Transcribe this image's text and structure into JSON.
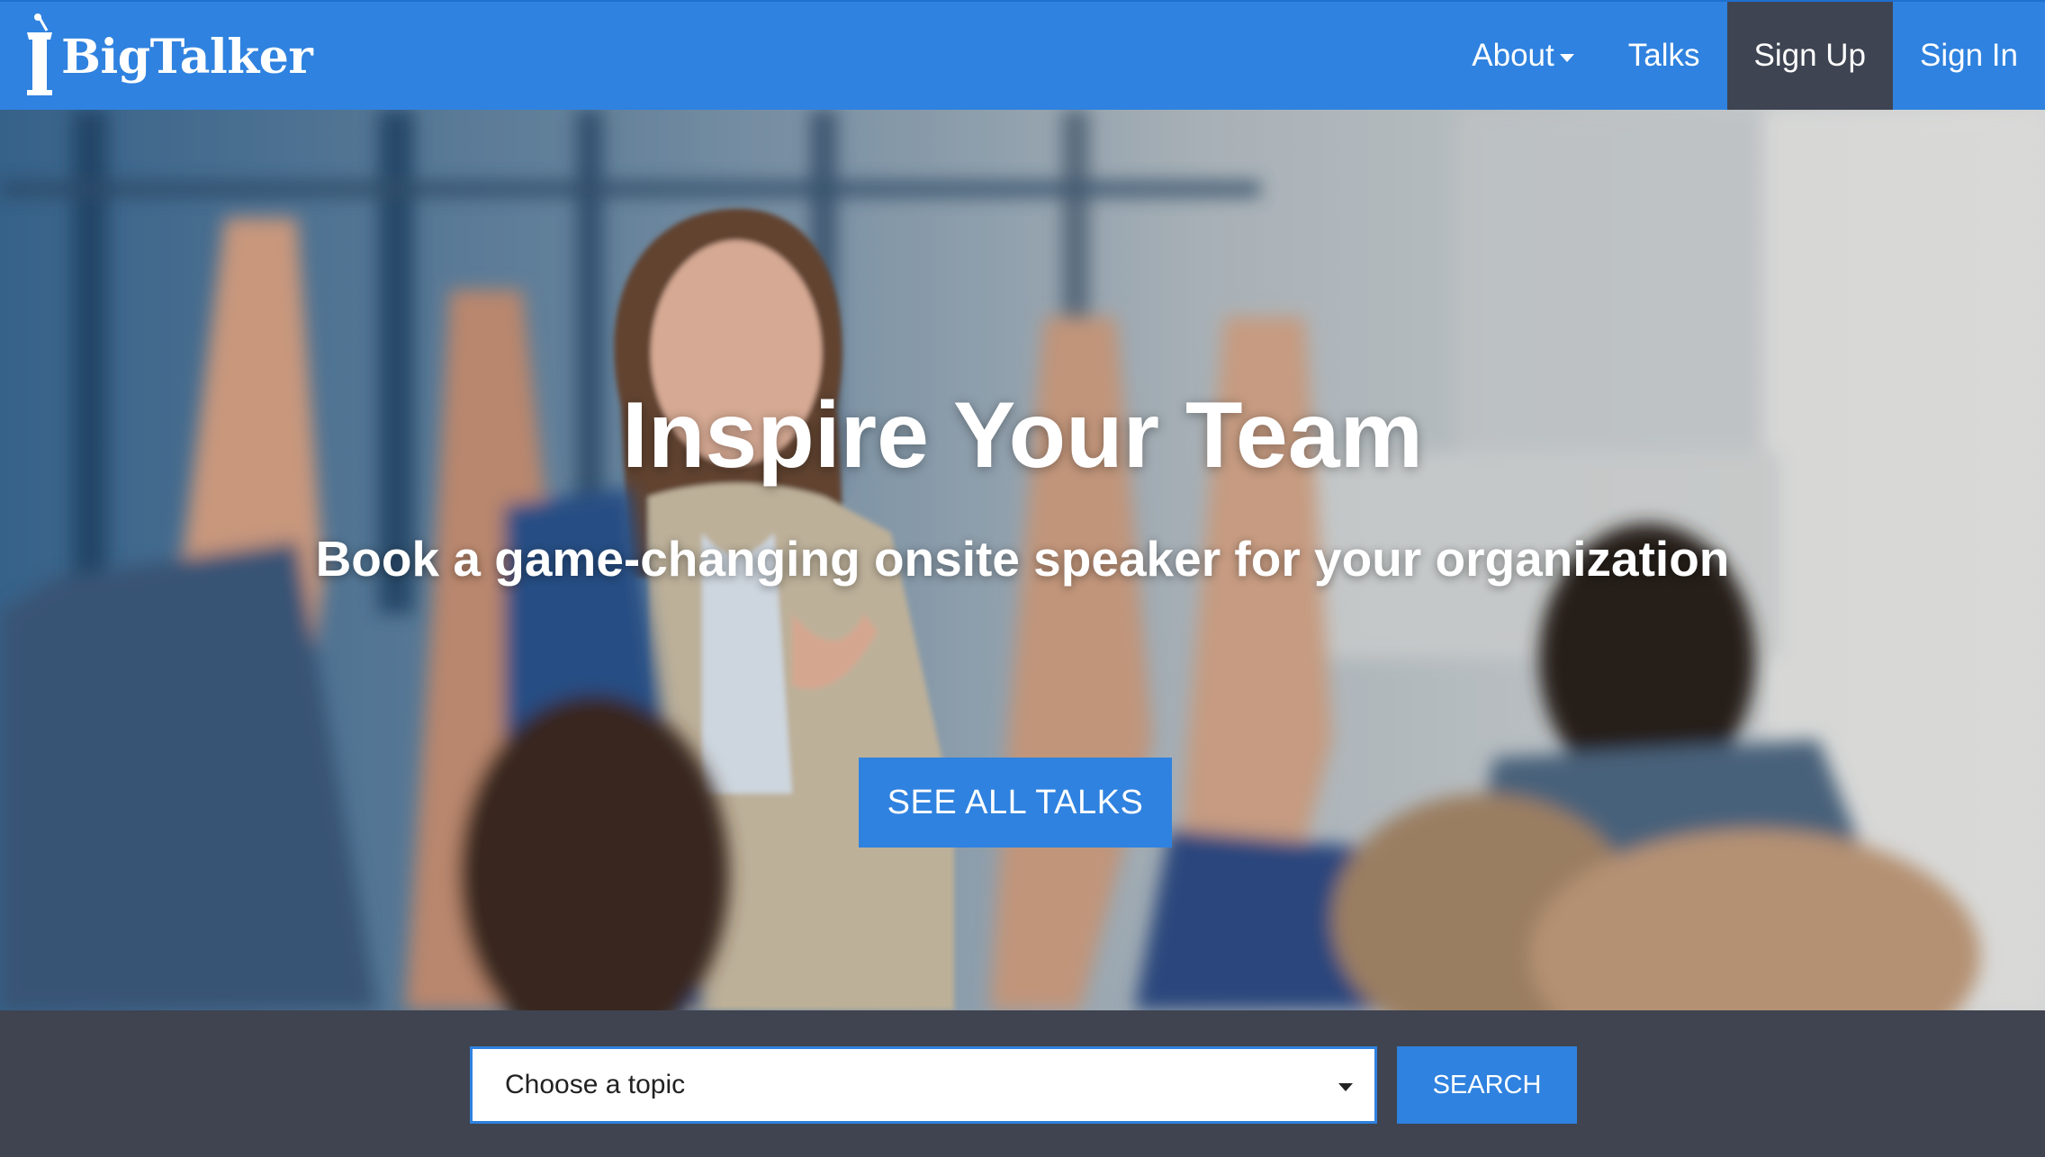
{
  "brand": {
    "name": "BigTalker",
    "logo_icon": "podium-icon"
  },
  "nav": {
    "items": [
      {
        "label": "About",
        "has_dropdown": true
      },
      {
        "label": "Talks"
      },
      {
        "label": "Sign Up",
        "active": true
      },
      {
        "label": "Sign In"
      }
    ]
  },
  "hero": {
    "title": "Inspire Your Team",
    "subtitle": "Book a game-changing onsite speaker for your organization",
    "cta_label": "SEE ALL TALKS"
  },
  "search": {
    "topic_placeholder": "Choose a topic",
    "button_label": "SEARCH"
  },
  "colors": {
    "primary": "#2f82df",
    "nav_active": "#3e4452",
    "footer_band": "#3f4450"
  }
}
